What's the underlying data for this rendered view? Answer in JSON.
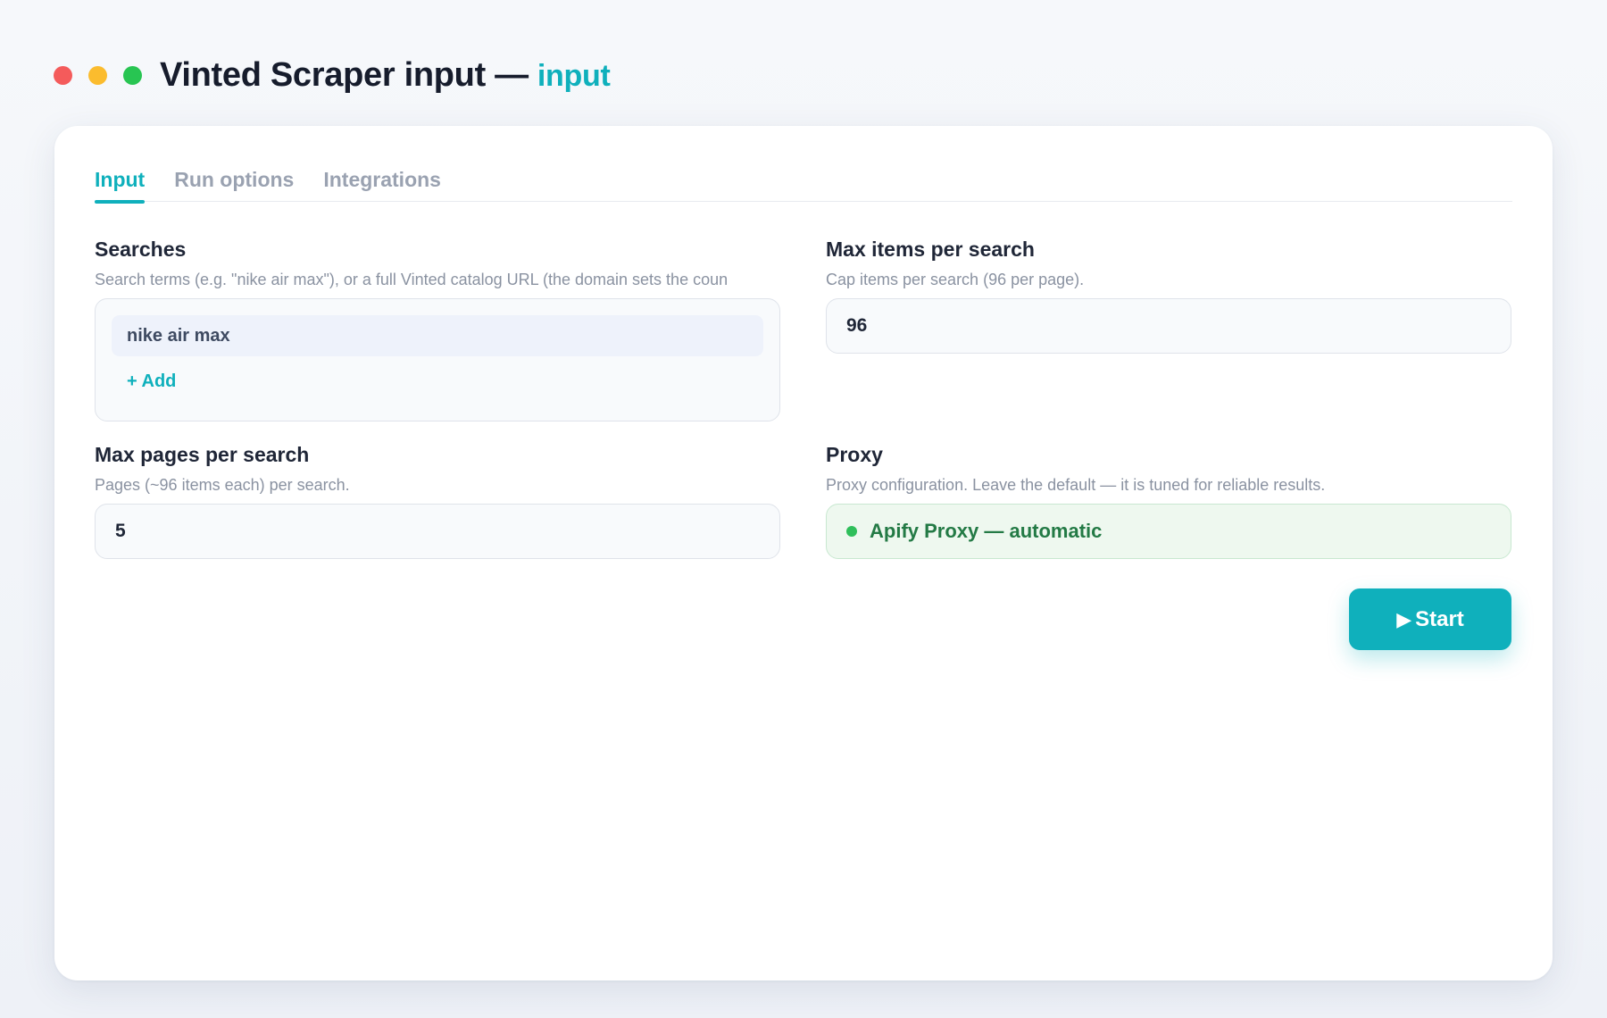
{
  "window": {
    "title": "Vinted Scraper input —",
    "title_accent": "input"
  },
  "tabs": [
    {
      "label": "Input",
      "active": true
    },
    {
      "label": "Run options",
      "active": false
    },
    {
      "label": "Integrations",
      "active": false
    }
  ],
  "fields": {
    "searches": {
      "label": "Searches",
      "description": "Search terms (e.g. \"nike air max\"), or a full Vinted catalog URL (the domain sets the coun",
      "items": [
        "nike air max"
      ],
      "add_label": "+ Add"
    },
    "max_items": {
      "label": "Max items per search",
      "description": "Cap items per search (96 per page).",
      "value": "96"
    },
    "max_pages": {
      "label": "Max pages per search",
      "description": "Pages (~96 items each) per search.",
      "value": "5"
    },
    "proxy": {
      "label": "Proxy",
      "description": "Proxy configuration. Leave the default — it is tuned for reliable results.",
      "value": "Apify Proxy — automatic"
    }
  },
  "actions": {
    "start_icon": "play-icon",
    "start_label": "Start"
  },
  "colors": {
    "accent": "#0fb0bc",
    "proxy_status": "#2fbf5b",
    "proxy_text": "#237a45"
  }
}
